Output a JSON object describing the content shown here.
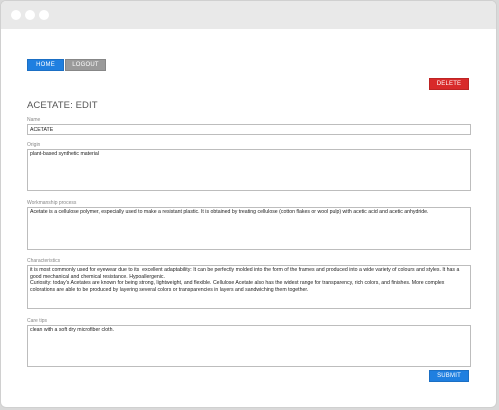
{
  "nav": {
    "home_label": "HOME",
    "logout_label": "LOGOUT"
  },
  "actions": {
    "delete_label": "DELETE",
    "submit_label": "SUBMIT"
  },
  "page": {
    "title": "ACETATE: EDIT"
  },
  "form": {
    "name": {
      "label": "Name",
      "value": "ACETATE"
    },
    "origin": {
      "label": "Origin",
      "value": "plant-based synthetic material"
    },
    "workmanship": {
      "label": "Workmanship process",
      "value": "Acetate is a cellulose polymer, especially used to make a resistant plastic. It is obtained by treating cellulose (cotton flakes or wool pulp) with acetic acid and acetic anhydride."
    },
    "characteristics": {
      "label": "Characteristics",
      "value": "it is most commonly used for eyewear due to its  excellent adaptability: It can be perfectly molded into the form of the frames and produced into a wide variety of colours and styles. It has a good mechanical and chemical resistance. Hypoallergenic.\nCuriosity: today's Acetates are known for being strong, lightweight, and flexible. Cellulose Acetate also has the widest range for transparency, rich colors, and finishes. More complex colorations are able to be produced by layering several colors or transparencies in layers and sandwiching them together."
    },
    "care": {
      "label": "Care tips",
      "value": "clean with a soft dry microfiber cloth."
    }
  },
  "colors": {
    "primary": "#1f7fe0",
    "secondary": "#9a9a9a",
    "danger": "#d82a2a",
    "titlebar": "#e9e9e9"
  }
}
